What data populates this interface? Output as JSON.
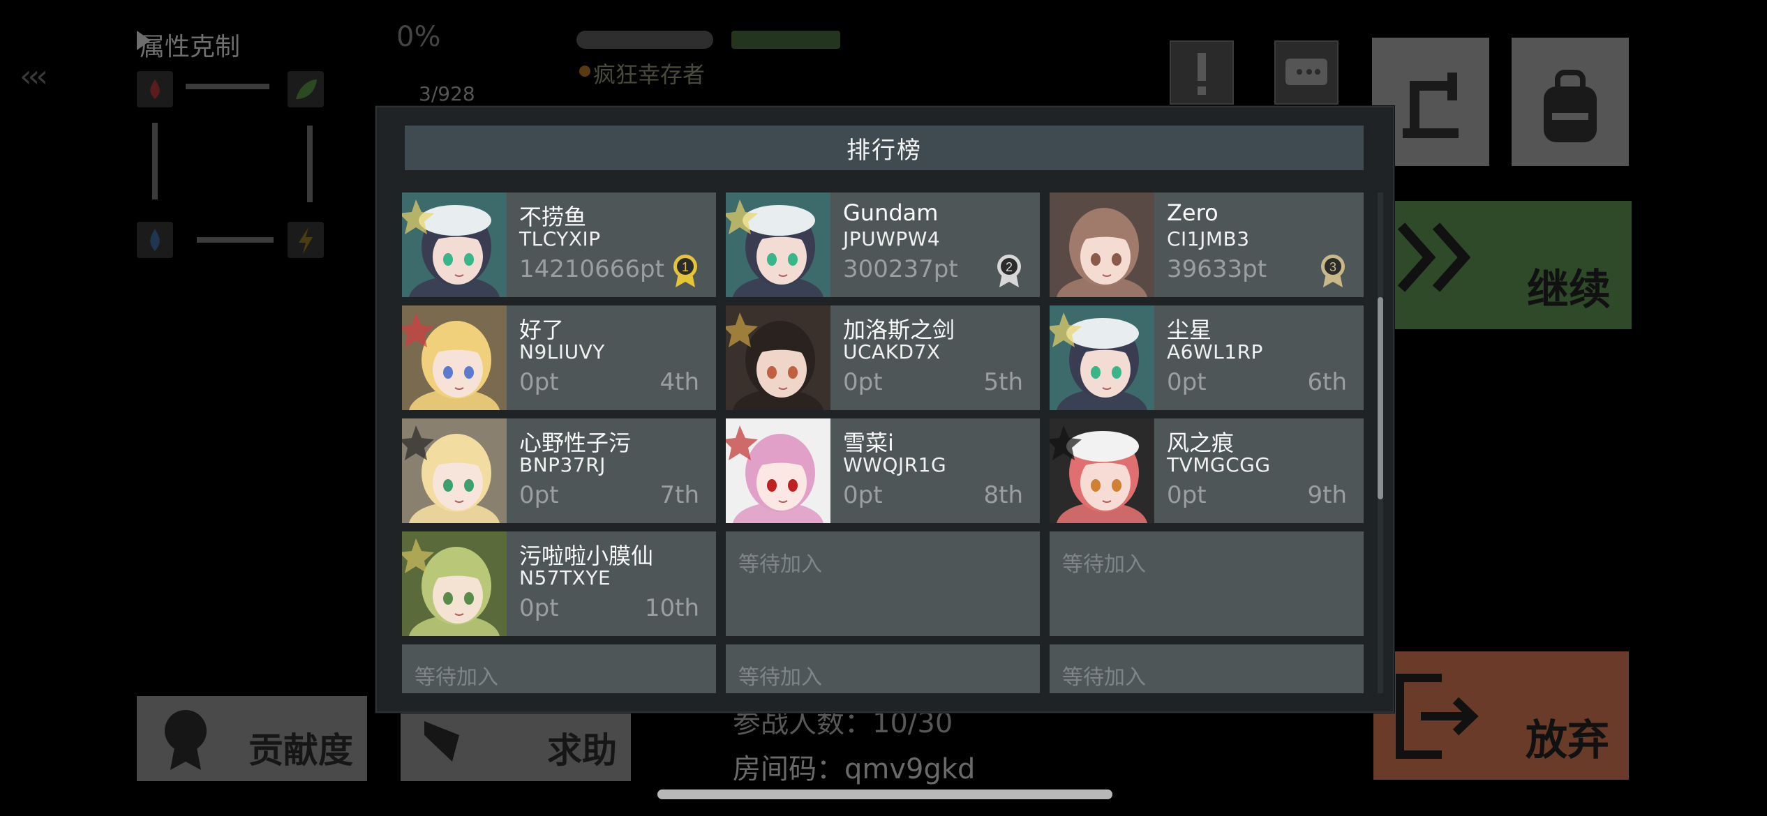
{
  "background": {
    "attribute_title": "属性克制",
    "back_icon": "chevrons-left-icon",
    "percent": "0%",
    "goal_text": "疯狂幸存者",
    "resource_count": "3/928",
    "continue_label": "继续",
    "give_up_label": "放弃",
    "contribution_label": "贡献度",
    "help_label": "求助",
    "players_text": "参战人数：10/30",
    "room_code_text": "房间码：qmv9gkd",
    "colors": {
      "continue": "#2e4a29",
      "give_up": "#6a3b28"
    }
  },
  "leaderboard": {
    "title": "排行榜",
    "wait_label": "等待加入",
    "entries": [
      {
        "name": "不捞鱼",
        "id": "TLCYXIP",
        "score": "14210666pt",
        "rank": "1",
        "medal": "gold",
        "avatar": "girl-beret"
      },
      {
        "name": "Gundam",
        "id": "JPUWPW4",
        "score": "300237pt",
        "rank": "2",
        "medal": "silver",
        "avatar": "girl-beret"
      },
      {
        "name": "Zero",
        "id": "CI1JMB3",
        "score": "39633pt",
        "rank": "3",
        "medal": "bronze",
        "avatar": "girl-brown-hair"
      },
      {
        "name": "好了",
        "id": "N9LIUVY",
        "score": "0pt",
        "rank": "4th",
        "avatar": "girl-blonde-cat"
      },
      {
        "name": "加洛斯之剑",
        "id": "UCAKD7X",
        "score": "0pt",
        "rank": "5th",
        "avatar": "girl-dark-hair"
      },
      {
        "name": "尘星",
        "id": "A6WL1RP",
        "score": "0pt",
        "rank": "6th",
        "avatar": "girl-beret"
      },
      {
        "name": "心野性子污",
        "id": "BNP37RJ",
        "score": "0pt",
        "rank": "7th",
        "avatar": "girl-blonde"
      },
      {
        "name": "雪菜i",
        "id": "WWQJR1G",
        "score": "0pt",
        "rank": "8th",
        "avatar": "chibi-pink"
      },
      {
        "name": "风之痕",
        "id": "TVMGCGG",
        "score": "0pt",
        "rank": "9th",
        "avatar": "girl-red-cap"
      },
      {
        "name": "污啦啦小膜仙",
        "id": "N57TXYE",
        "score": "0pt",
        "rank": "10th",
        "avatar": "girl-green-hair"
      }
    ],
    "empty_slots": 5
  }
}
